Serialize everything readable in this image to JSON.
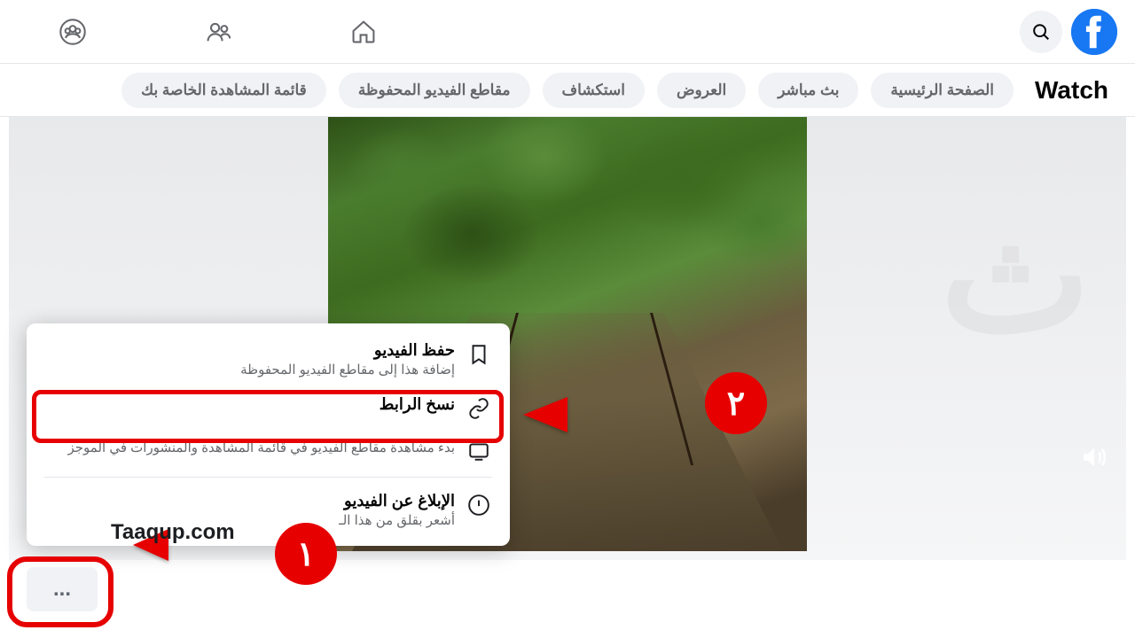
{
  "header": {
    "app_name": "facebook"
  },
  "subnav": {
    "title": "Watch",
    "tabs": [
      "الصفحة الرئيسية",
      "بث مباشر",
      "العروض",
      "استكشاف",
      "مقاطع الفيديو المحفوظة",
      "قائمة المشاهدة الخاصة بك"
    ]
  },
  "context_menu": {
    "items": [
      {
        "title": "حفظ الفيديو",
        "subtitle": "إضافة هذا إلى مقاطع الفيديو المحفوظة"
      },
      {
        "title": "نسخ الرابط",
        "subtitle": ""
      },
      {
        "title": "",
        "subtitle": "بدء مشاهدة مقاطع الفيديو في قائمة المشاهدة والمنشورات في الموجز"
      },
      {
        "title": "الإبلاغ عن الفيديو",
        "subtitle": "أشعر بقلق من هذا الـ"
      }
    ]
  },
  "annotations": {
    "step1": "١",
    "step2": "٢",
    "credit": "Taaqup.com"
  },
  "more_button": "..."
}
